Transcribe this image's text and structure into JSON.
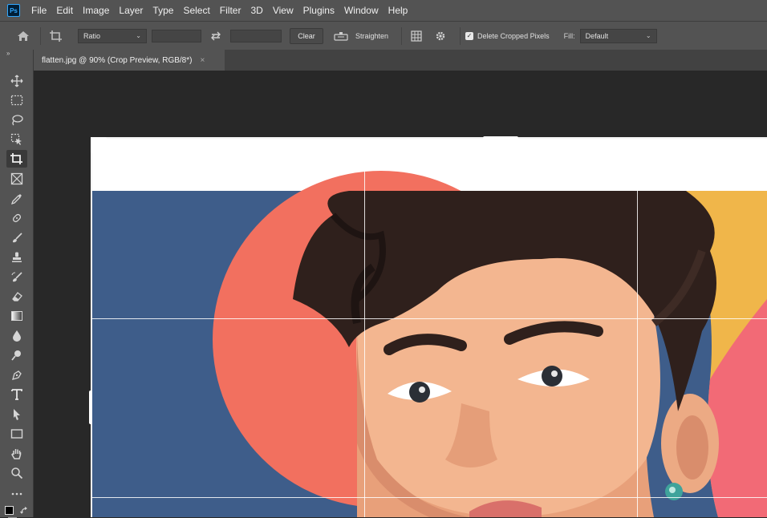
{
  "menu": [
    "File",
    "Edit",
    "Image",
    "Layer",
    "Type",
    "Select",
    "Filter",
    "3D",
    "View",
    "Plugins",
    "Window",
    "Help"
  ],
  "app_logo": "Ps",
  "options": {
    "ratio_label": "Ratio",
    "clear_label": "Clear",
    "straighten_label": "Straighten",
    "delete_cropped_label": "Delete Cropped Pixels",
    "fill_label": "Fill:",
    "fill_value": "Default"
  },
  "document": {
    "tab_title": "flatten.jpg @ 90% (Crop Preview, RGB/8*)",
    "close_glyph": "×"
  },
  "icons": {
    "home": "home-icon",
    "crop": "crop-icon",
    "swap": "swap-arrows-icon",
    "straighten": "level-icon",
    "grid": "grid-overlay-icon",
    "settings": "gear-icon"
  },
  "colors": {
    "panel": "#535353",
    "canvas": "#282828",
    "accent_ps": "#31a8ff"
  }
}
